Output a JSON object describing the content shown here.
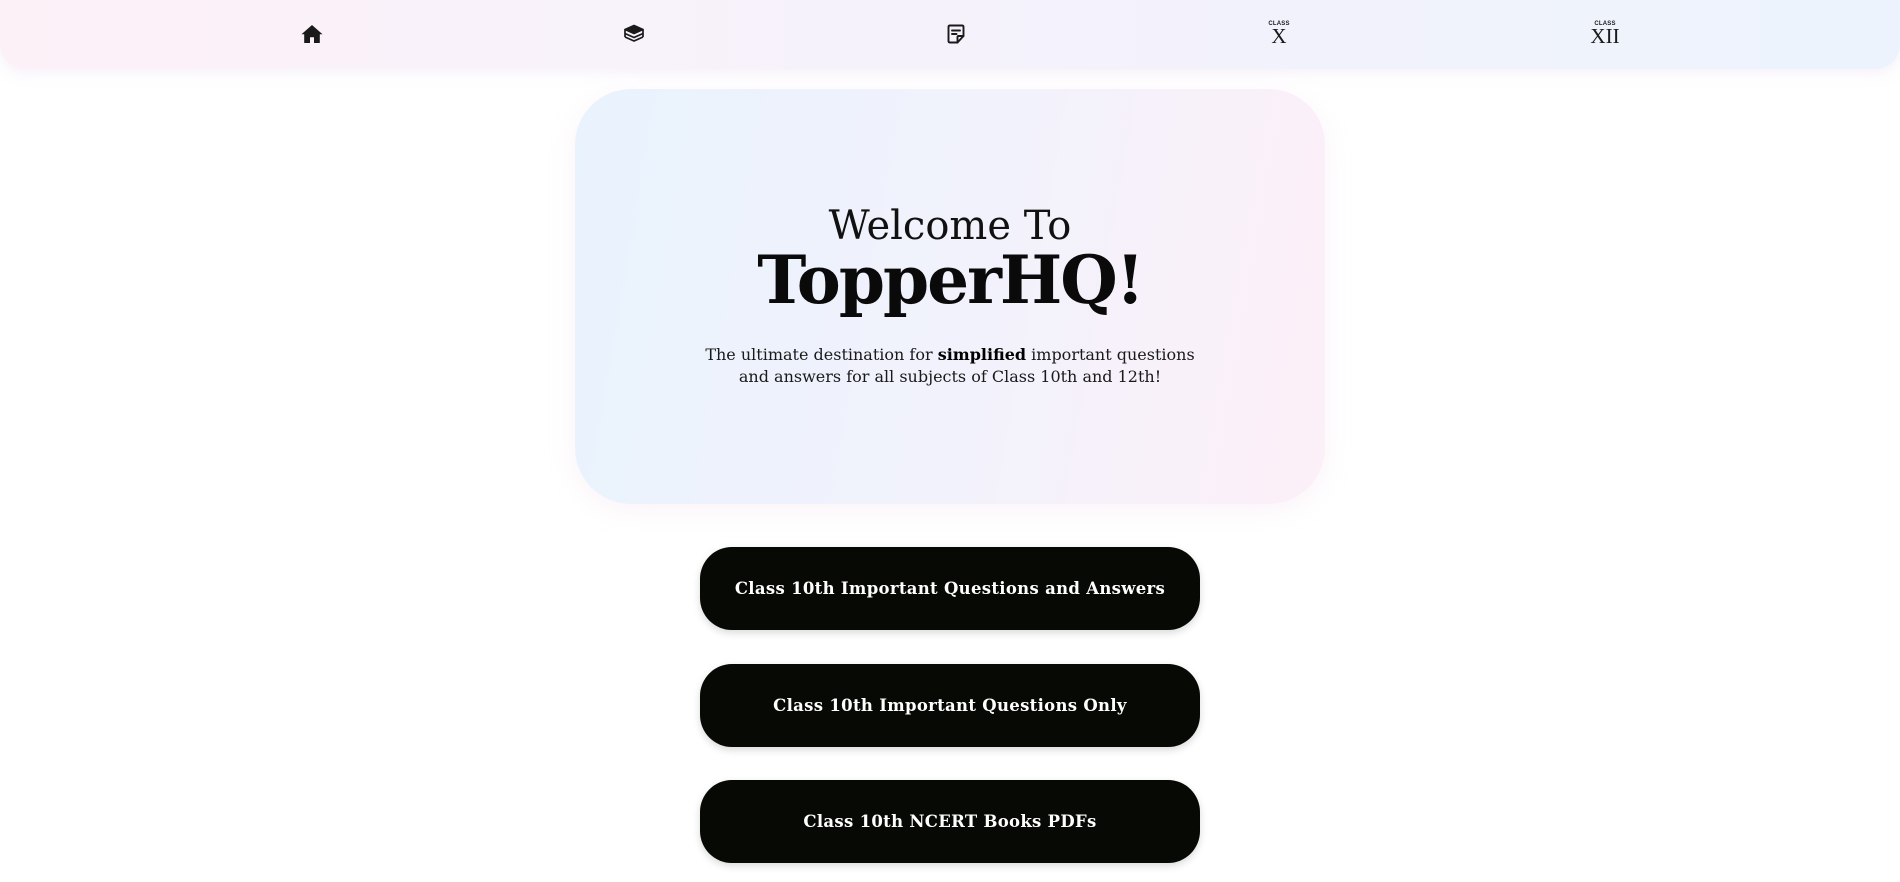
{
  "nav": {
    "items": [
      {
        "icon": "home-icon",
        "label": ""
      },
      {
        "icon": "books-stack-icon",
        "label": ""
      },
      {
        "icon": "notes-icon",
        "label": ""
      },
      {
        "icon": "class-x-icon",
        "small": "CLASS",
        "big": "X"
      },
      {
        "icon": "class-xii-icon",
        "small": "CLASS",
        "big": "XII"
      }
    ]
  },
  "hero": {
    "welcome": "Welcome To",
    "brand": "TopperHQ!",
    "tagline_pre": "The ultimate destination for ",
    "tagline_bold": "simplified",
    "tagline_post": " important questions and answers for all subjects of Class 10th and 12th!"
  },
  "buttons": [
    {
      "label": "Class 10th Important Questions and Answers"
    },
    {
      "label": "Class 10th Important Questions Only"
    },
    {
      "label": "Class 10th NCERT Books PDFs"
    }
  ],
  "colors": {
    "button_bg": "#070904",
    "button_text": "#ffffff",
    "text": "#111111"
  }
}
